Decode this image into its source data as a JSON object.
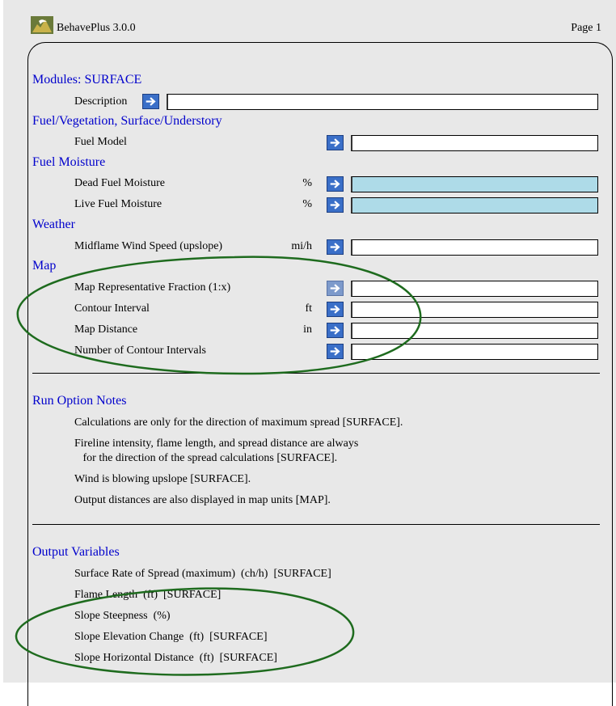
{
  "header": {
    "app_title": "BehavePlus 3.0.0",
    "page_label": "Page 1"
  },
  "sections": {
    "modules": "Modules: SURFACE",
    "description_label": "Description",
    "fuel_veg": "Fuel/Vegetation, Surface/Understory",
    "fuel_model_label": "Fuel Model",
    "fuel_moisture": "Fuel Moisture",
    "dead_label": "Dead Fuel Moisture",
    "dead_unit": "%",
    "live_label": "Live Fuel Moisture",
    "live_unit": "%",
    "weather": "Weather",
    "wind_label": "Midflame Wind Speed (upslope)",
    "wind_unit": "mi/h",
    "map": "Map",
    "map_rep_label": "Map Representative Fraction (1:x)",
    "contour_label": "Contour Interval",
    "contour_unit": "ft",
    "map_dist_label": "Map Distance",
    "map_dist_unit": "in",
    "num_contour_label": "Number of Contour Intervals"
  },
  "run_notes": {
    "heading": "Run Option Notes",
    "lines": [
      "Calculations are only for the direction of maximum spread [SURFACE].",
      "Fireline intensity, flame length, and spread distance are always",
      "   for the direction of the spread calculations [SURFACE].",
      "Wind is blowing upslope [SURFACE].",
      "Output distances are also displayed in map units [MAP]."
    ]
  },
  "outputs": {
    "heading": "Output Variables",
    "items": [
      "Surface Rate of Spread (maximum)  (ch/h)  [SURFACE]",
      "Flame Length  (ft)  [SURFACE]",
      "Slope Steepness  (%)",
      "Slope Elevation Change  (ft)  [SURFACE]",
      "Slope Horizontal Distance  (ft)  [SURFACE]"
    ]
  },
  "colors": {
    "heading": "#0000cc",
    "highlight_field": "#aedbe8",
    "annotation_ellipse": "#1e6b1e"
  }
}
